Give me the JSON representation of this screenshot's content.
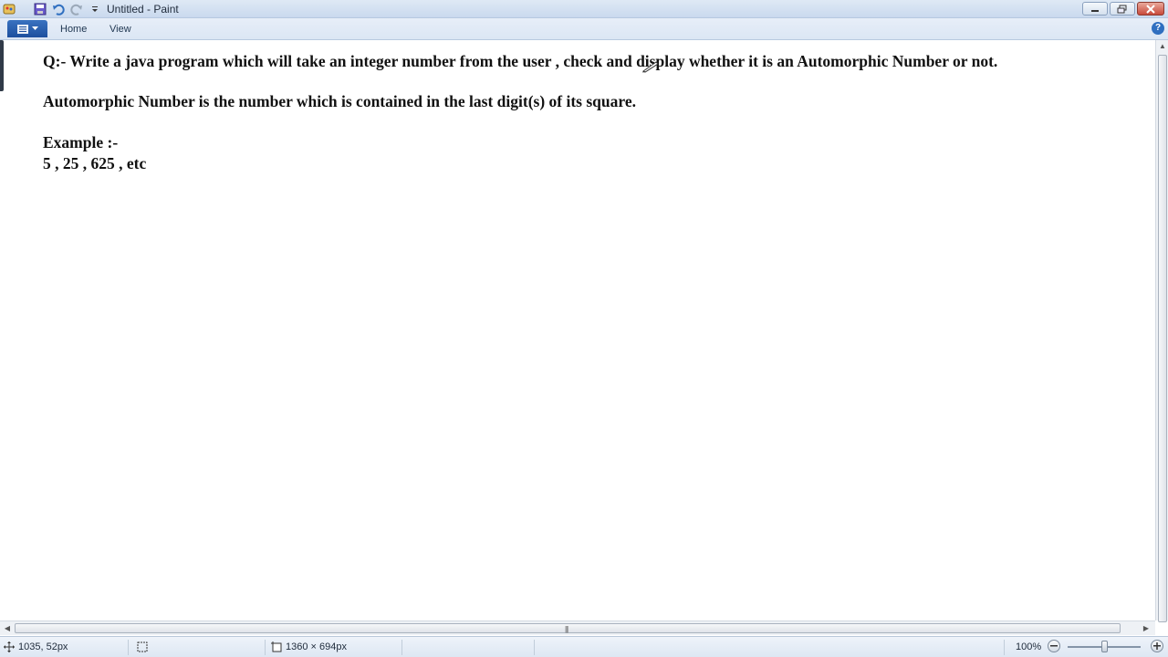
{
  "window": {
    "title": "Untitled - Paint"
  },
  "ribbon": {
    "tabs": [
      "Home",
      "View"
    ],
    "help_label": "?"
  },
  "document": {
    "line1": "Q:- Write a java program which will take an integer number from the user , check and display whether it is an Automorphic Number or not.",
    "line2": "Automorphic Number is the number which is contained in the last digit(s) of its square.",
    "line3": "Example :-",
    "line4": "5 , 25 , 625 , etc"
  },
  "statusbar": {
    "cursor_position": "1035, 52px",
    "image_size": "1360 × 694px",
    "zoom": "100%"
  }
}
